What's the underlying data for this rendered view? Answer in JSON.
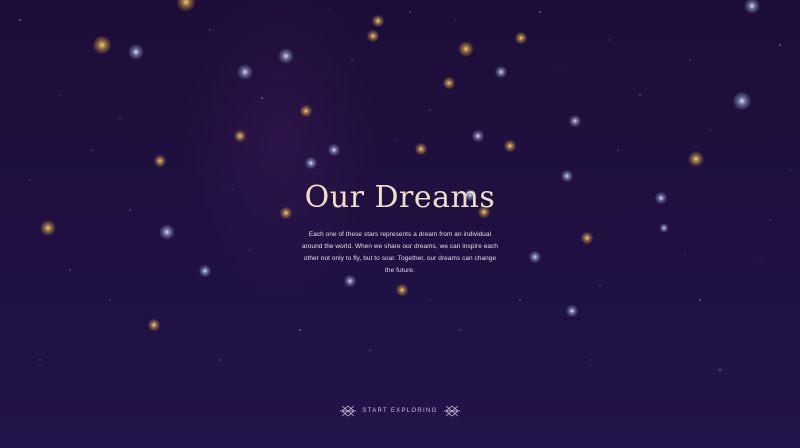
{
  "hero": {
    "title": "Our Dreams",
    "description": "Each one of these stars represents a dream from an individual around the world. When we share our dreams, we can inspire each other not only to fly, but to soar. Together, our dreams can change the future."
  },
  "cta": {
    "label": "START EXPLORING",
    "ornament_icon": "ornament-icon"
  },
  "colors": {
    "background_top": "#1c0d38",
    "background_bottom": "#22134a",
    "title": "#f1dcc7",
    "star_gold": "#d7a43e",
    "star_blue": "#aab7dc"
  }
}
